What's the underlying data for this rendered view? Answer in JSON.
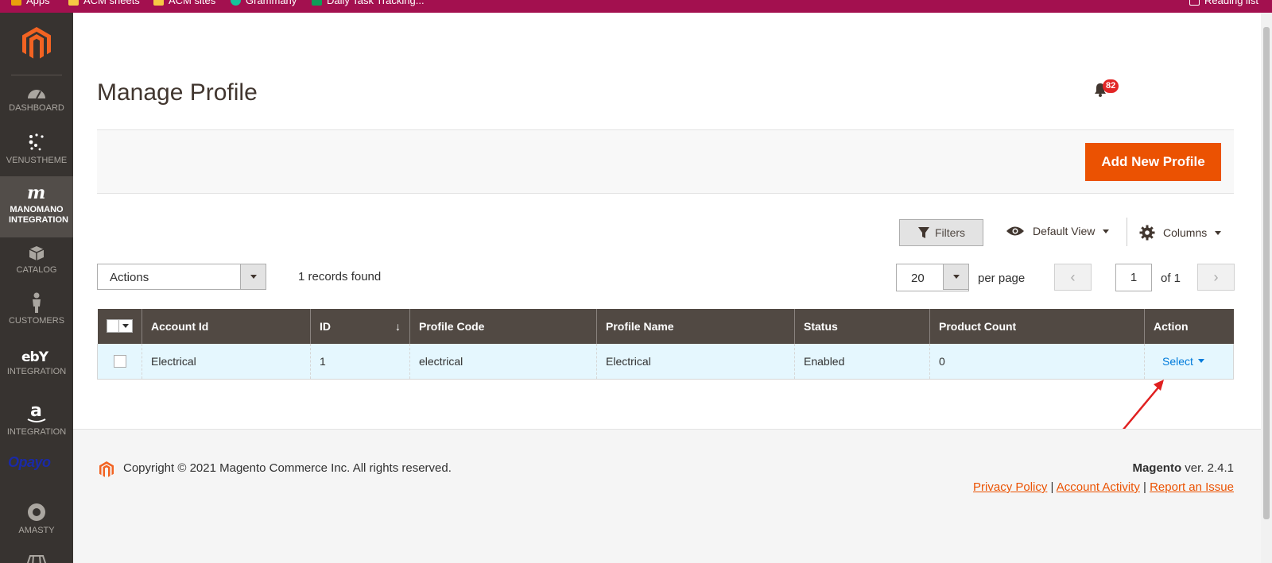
{
  "browser": {
    "bookmarks": [
      {
        "label": "Apps",
        "color": "#e8a20c"
      },
      {
        "label": "ACM sheets",
        "color": "#f6c944"
      },
      {
        "label": "ACM sites",
        "color": "#f6c944"
      },
      {
        "label": "Grammarly",
        "color": "#15c39a"
      },
      {
        "label": "Daily Task Tracking...",
        "color": "#0f9d58"
      },
      {
        "label": "Reading list",
        "color": "#ffffff"
      }
    ]
  },
  "sidebar": {
    "items": [
      {
        "label": "DASHBOARD",
        "icon": "gauge-icon"
      },
      {
        "label": "VENUSTHEME",
        "icon": "sparkle-icon"
      },
      {
        "label": "MANOMANO INTEGRATION",
        "icon": "manomano-icon"
      },
      {
        "label": "CATALOG",
        "icon": "box-icon"
      },
      {
        "label": "CUSTOMERS",
        "icon": "person-icon"
      },
      {
        "label": "INTEGRATION",
        "icon": "ebay-icon"
      },
      {
        "label": "INTEGRATION",
        "icon": "amazon-icon"
      },
      {
        "label": "AMASTY",
        "icon": "amasty-icon"
      }
    ],
    "opayo": "Opayo"
  },
  "header": {
    "title": "Manage Profile",
    "notifications": "82"
  },
  "toolbar": {
    "add_label": "Add New Profile",
    "filters_label": "Filters",
    "view_label": "Default View",
    "columns_label": "Columns",
    "actions_label": "Actions",
    "records_found": "1 records found",
    "per_page_value": "20",
    "per_page_label": "per page",
    "page_value": "1",
    "page_of": "of 1"
  },
  "grid": {
    "columns": [
      "Account Id",
      "ID",
      "Profile Code",
      "Profile Name",
      "Status",
      "Product Count",
      "Action"
    ],
    "sort_indicator": "↓",
    "rows": [
      {
        "account_id": "Electrical",
        "id": "1",
        "profile_code": "electrical",
        "profile_name": "Electrical",
        "status": "Enabled",
        "product_count": "0",
        "action": "Select"
      }
    ]
  },
  "footer": {
    "copyright": "Copyright © 2021 Magento Commerce Inc. All rights reserved.",
    "brand": "Magento",
    "version": " ver. 2.4.1",
    "links": [
      "Privacy Policy",
      "Account Activity",
      "Report an Issue"
    ]
  },
  "colors": {
    "sidebar": "#373330",
    "accent": "#eb5202",
    "header_row": "#514943",
    "selected_row": "#e5f7fe",
    "browser_bar": "#a3104f"
  }
}
